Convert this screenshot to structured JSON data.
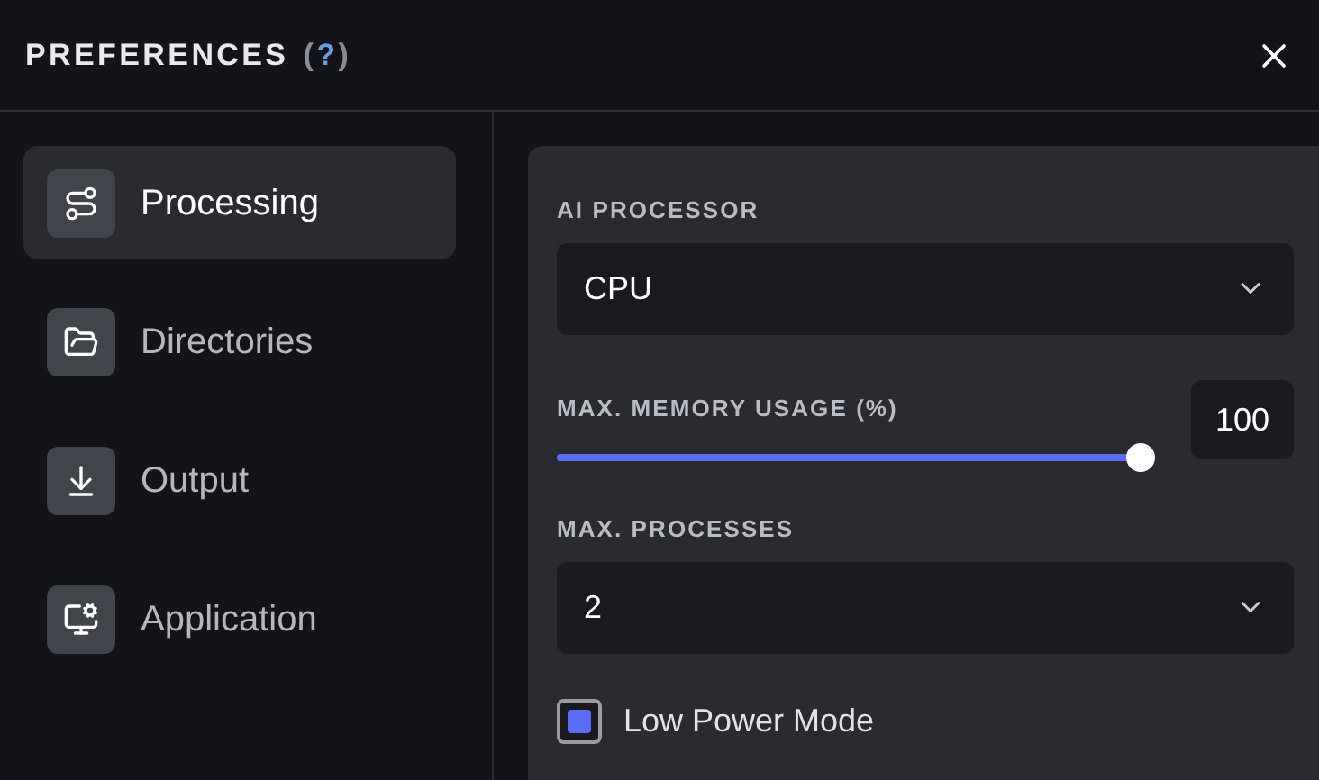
{
  "header": {
    "title": "PREFERENCES",
    "help": {
      "open": "(",
      "mark": "?",
      "close": ")"
    }
  },
  "sidebar": {
    "items": [
      {
        "label": "Processing",
        "selected": true
      },
      {
        "label": "Directories",
        "selected": false
      },
      {
        "label": "Output",
        "selected": false
      },
      {
        "label": "Application",
        "selected": false
      }
    ]
  },
  "settings": [
    {
      "kind": "select",
      "label": "AI PROCESSOR",
      "value": "CPU"
    },
    {
      "kind": "slider",
      "label": "MAX. MEMORY USAGE (%)",
      "level": 1,
      "reading": "100"
    },
    {
      "kind": "select",
      "label": "MAX. PROCESSES",
      "value": "2"
    },
    {
      "kind": "checkbox",
      "label": "Low Power Mode",
      "checked": true
    }
  ]
}
